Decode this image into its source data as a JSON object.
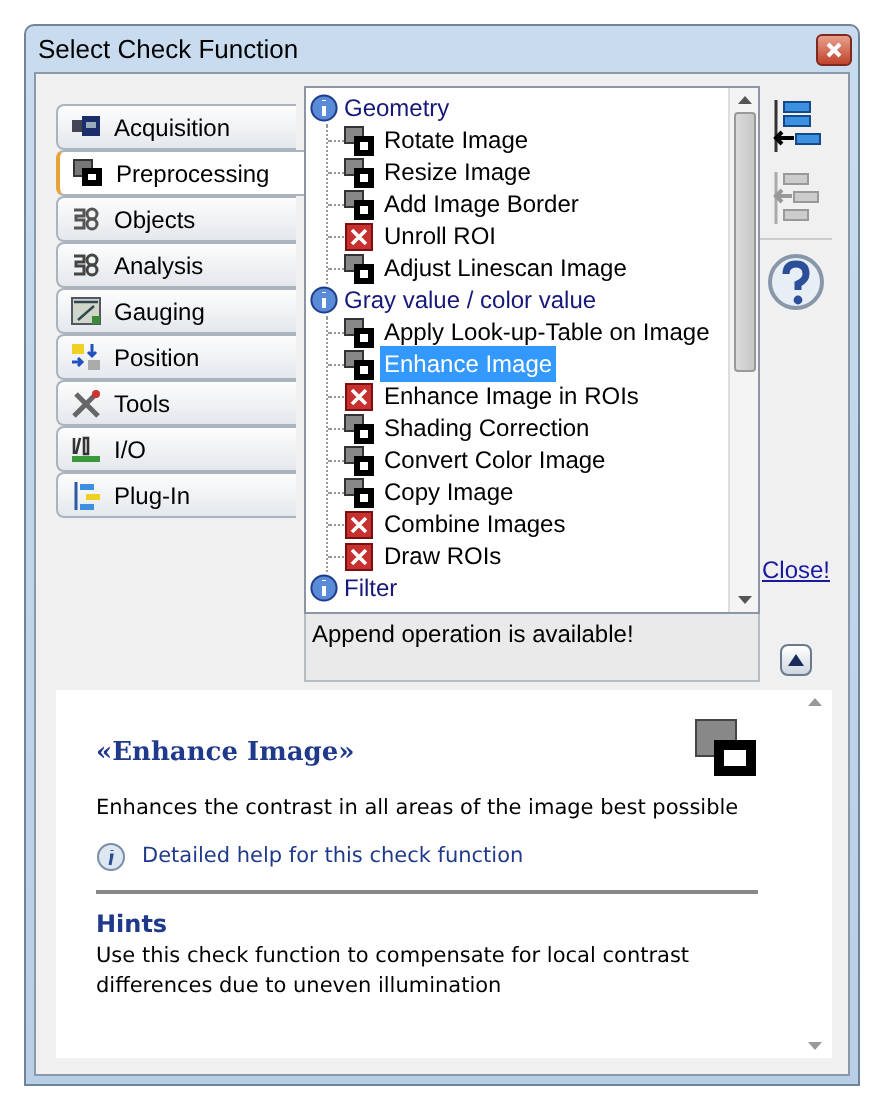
{
  "window": {
    "title": "Select Check Function"
  },
  "tabs": [
    {
      "label": "Acquisition",
      "selected": false
    },
    {
      "label": "Preprocessing",
      "selected": true
    },
    {
      "label": "Objects",
      "selected": false
    },
    {
      "label": "Analysis",
      "selected": false
    },
    {
      "label": "Gauging",
      "selected": false
    },
    {
      "label": "Position",
      "selected": false
    },
    {
      "label": "Tools",
      "selected": false
    },
    {
      "label": "I/O",
      "selected": false
    },
    {
      "label": "Plug-In",
      "selected": false
    }
  ],
  "tree": [
    {
      "label": "Geometry",
      "children": [
        {
          "label": "Rotate Image",
          "kind": "available",
          "selected": false
        },
        {
          "label": "Resize Image",
          "kind": "available",
          "selected": false
        },
        {
          "label": "Add Image Border",
          "kind": "available",
          "selected": false
        },
        {
          "label": "Unroll ROI",
          "kind": "unavailable",
          "selected": false
        },
        {
          "label": "Adjust Linescan Image",
          "kind": "available",
          "selected": false
        }
      ]
    },
    {
      "label": "Gray value / color value",
      "children": [
        {
          "label": "Apply Look-up-Table on Image",
          "kind": "available",
          "selected": false
        },
        {
          "label": "Enhance Image",
          "kind": "available",
          "selected": true
        },
        {
          "label": "Enhance Image in ROIs",
          "kind": "unavailable",
          "selected": false
        },
        {
          "label": "Shading Correction",
          "kind": "available",
          "selected": false
        },
        {
          "label": "Convert Color Image",
          "kind": "available",
          "selected": false
        },
        {
          "label": "Copy Image",
          "kind": "available",
          "selected": false
        },
        {
          "label": "Combine Images",
          "kind": "unavailable",
          "selected": false
        },
        {
          "label": "Draw ROIs",
          "kind": "unavailable",
          "selected": false
        }
      ]
    },
    {
      "label": "Filter"
    }
  ],
  "status": "Append operation is available!",
  "close_link": "Close!",
  "help": {
    "title": "«Enhance Image»",
    "description": "Enhances the contrast in all areas of the image best possible",
    "link": "Detailed help for this check function",
    "hints_title": "Hints",
    "hints": "Use this check function to compensate for local contrast differences due to uneven illumination"
  }
}
